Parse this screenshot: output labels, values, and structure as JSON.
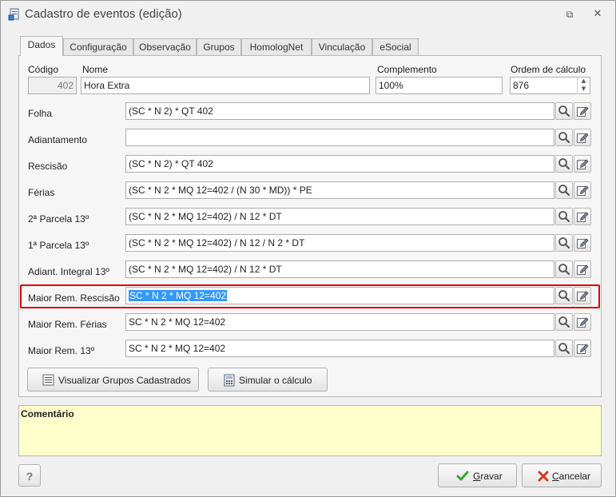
{
  "window": {
    "title": "Cadastro de eventos (edição)",
    "restore_glyph": "⧉",
    "close_glyph": "✕"
  },
  "tabs": [
    {
      "label": "Dados",
      "active": true
    },
    {
      "label": "Configuração",
      "active": false
    },
    {
      "label": "Observação",
      "active": false
    },
    {
      "label": "Grupos",
      "active": false
    },
    {
      "label": "HomologNet",
      "active": false
    },
    {
      "label": "Vinculação",
      "active": false
    },
    {
      "label": "eSocial",
      "active": false
    }
  ],
  "header_fields": {
    "codigo": {
      "label": "Código",
      "value": "402"
    },
    "nome": {
      "label": "Nome",
      "value": "Hora Extra"
    },
    "complemento": {
      "label": "Complemento",
      "value": "100%"
    },
    "ordem": {
      "label": "Ordem de cálculo",
      "value": "876",
      "spin_up": "▲",
      "spin_down": "▼"
    }
  },
  "formula_rows": [
    {
      "label": "Folha",
      "value": "(SC * N 2) * QT 402",
      "selected": false
    },
    {
      "label": "Adiantamento",
      "value": "",
      "selected": false
    },
    {
      "label": "Rescisão",
      "value": "(SC * N 2) * QT 402",
      "selected": false
    },
    {
      "label": "Férias",
      "value": "(SC * N 2 * MQ 12=402 / (N 30 * MD)) * PE",
      "selected": false
    },
    {
      "label": "2ª Parcela 13º",
      "value": "(SC * N 2 * MQ 12=402) / N 12 * DT",
      "selected": false
    },
    {
      "label": "1ª Parcela 13º",
      "value": "(SC * N 2 * MQ 12=402) / N 12 / N 2 * DT",
      "selected": false
    },
    {
      "label": "Adiant. Integral 13º",
      "value": "(SC * N 2 * MQ 12=402) / N 12 * DT",
      "selected": false
    },
    {
      "label": "Maior Rem. Rescisão",
      "value": "SC * N 2 * MQ 12=402",
      "selected": true
    },
    {
      "label": "Maior Rem. Férias",
      "value": "SC * N 2 * MQ 12=402",
      "selected": false
    },
    {
      "label": "Maior Rem. 13º",
      "value": "SC * N 2 * MQ 12=402",
      "selected": false
    }
  ],
  "actions": {
    "visualizar_grupos": "Visualizar Grupos Cadastrados",
    "simular": "Simular o cálculo"
  },
  "comment": {
    "title": "Comentário"
  },
  "footer": {
    "help": "?",
    "gravar_first": "G",
    "gravar_rest": "ravar",
    "cancelar_first": "C",
    "cancelar_rest": "ancelar"
  },
  "colors": {
    "highlight": "#e00000",
    "selection": "#3399ff",
    "comment_bg": "#ffffcc"
  }
}
